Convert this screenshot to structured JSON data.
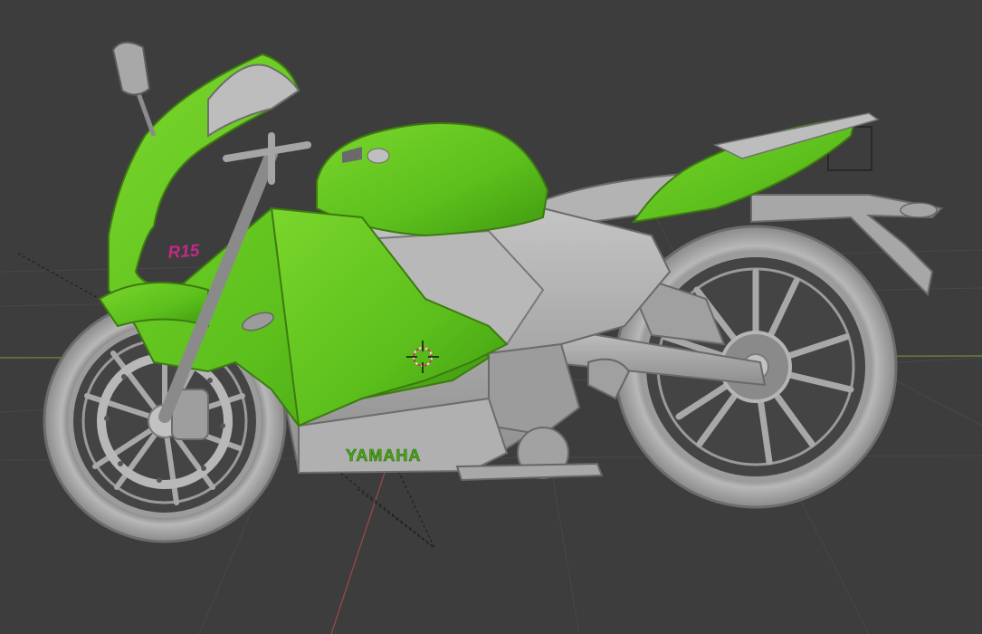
{
  "viewport": {
    "background": "#3d3d3d",
    "grid_color": "#484848",
    "x_axis_color": "#6f8a3a",
    "y_axis_color": "#9a4a4a"
  },
  "model": {
    "decal_brand": "YAMAHA",
    "decal_model": "R15",
    "body_color": "#5fc21c",
    "base_color": "#a9a9a9",
    "accent_color": "#c02a86"
  },
  "icons": {
    "cursor": "3d-cursor-icon"
  }
}
